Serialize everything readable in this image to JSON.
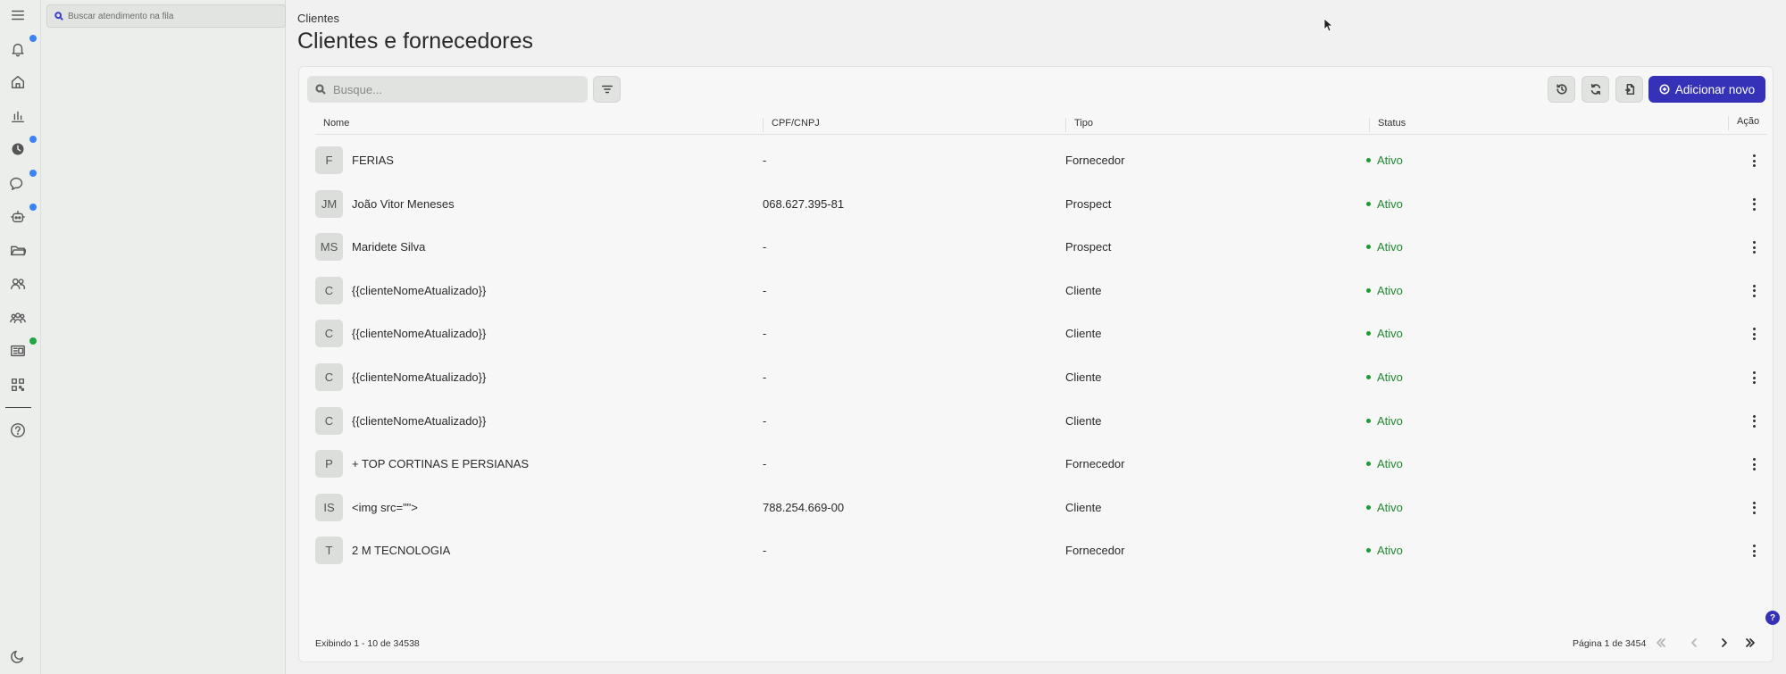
{
  "queue": {
    "search_placeholder": "Buscar atendimento na fila"
  },
  "header": {
    "breadcrumb": "Clientes",
    "title": "Clientes e fornecedores"
  },
  "toolbar": {
    "search_placeholder": "Busque...",
    "add_label": "Adicionar novo"
  },
  "table": {
    "columns": {
      "name": "Nome",
      "doc": "CPF/CNPJ",
      "type": "Tipo",
      "status": "Status",
      "action": "Ação"
    },
    "rows": [
      {
        "initials": "F",
        "name": "FERIAS",
        "doc": "-",
        "type": "Fornecedor",
        "status": "Ativo"
      },
      {
        "initials": "JM",
        "name": "João Vitor Meneses",
        "doc": "068.627.395-81",
        "type": "Prospect",
        "status": "Ativo"
      },
      {
        "initials": "MS",
        "name": "Maridete Silva",
        "doc": "-",
        "type": "Prospect",
        "status": "Ativo"
      },
      {
        "initials": "C",
        "name": "{{clienteNomeAtualizado}}",
        "doc": "-",
        "type": "Cliente",
        "status": "Ativo"
      },
      {
        "initials": "C",
        "name": "{{clienteNomeAtualizado}}",
        "doc": "-",
        "type": "Cliente",
        "status": "Ativo"
      },
      {
        "initials": "C",
        "name": "{{clienteNomeAtualizado}}",
        "doc": "-",
        "type": "Cliente",
        "status": "Ativo"
      },
      {
        "initials": "C",
        "name": "{{clienteNomeAtualizado}}",
        "doc": "-",
        "type": "Cliente",
        "status": "Ativo"
      },
      {
        "initials": "P",
        "name": "+ TOP CORTINAS E PERSIANAS",
        "doc": "-",
        "type": "Fornecedor",
        "status": "Ativo"
      },
      {
        "initials": "IS",
        "name": "<img src=\"\">",
        "doc": "788.254.669-00",
        "type": "Cliente",
        "status": "Ativo"
      },
      {
        "initials": "T",
        "name": "2 M TECNOLOGIA",
        "doc": "-",
        "type": "Fornecedor",
        "status": "Ativo"
      }
    ]
  },
  "footer": {
    "showing": "Exibindo 1 - 10 de 34538",
    "page": "Página 1 de 3454"
  },
  "colors": {
    "accent": "#3532b8",
    "status_active": "#1e8a2e",
    "badge_blue": "#3b82f6",
    "badge_green": "#22a745"
  },
  "rail_icons": [
    "menu-icon",
    "bell-icon",
    "home-icon",
    "chart-icon",
    "clock-icon",
    "chat-icon",
    "bot-icon",
    "folder-icon",
    "users-icon",
    "team-icon",
    "newspaper-icon",
    "qr-icon",
    "help-icon",
    "moon-icon"
  ]
}
